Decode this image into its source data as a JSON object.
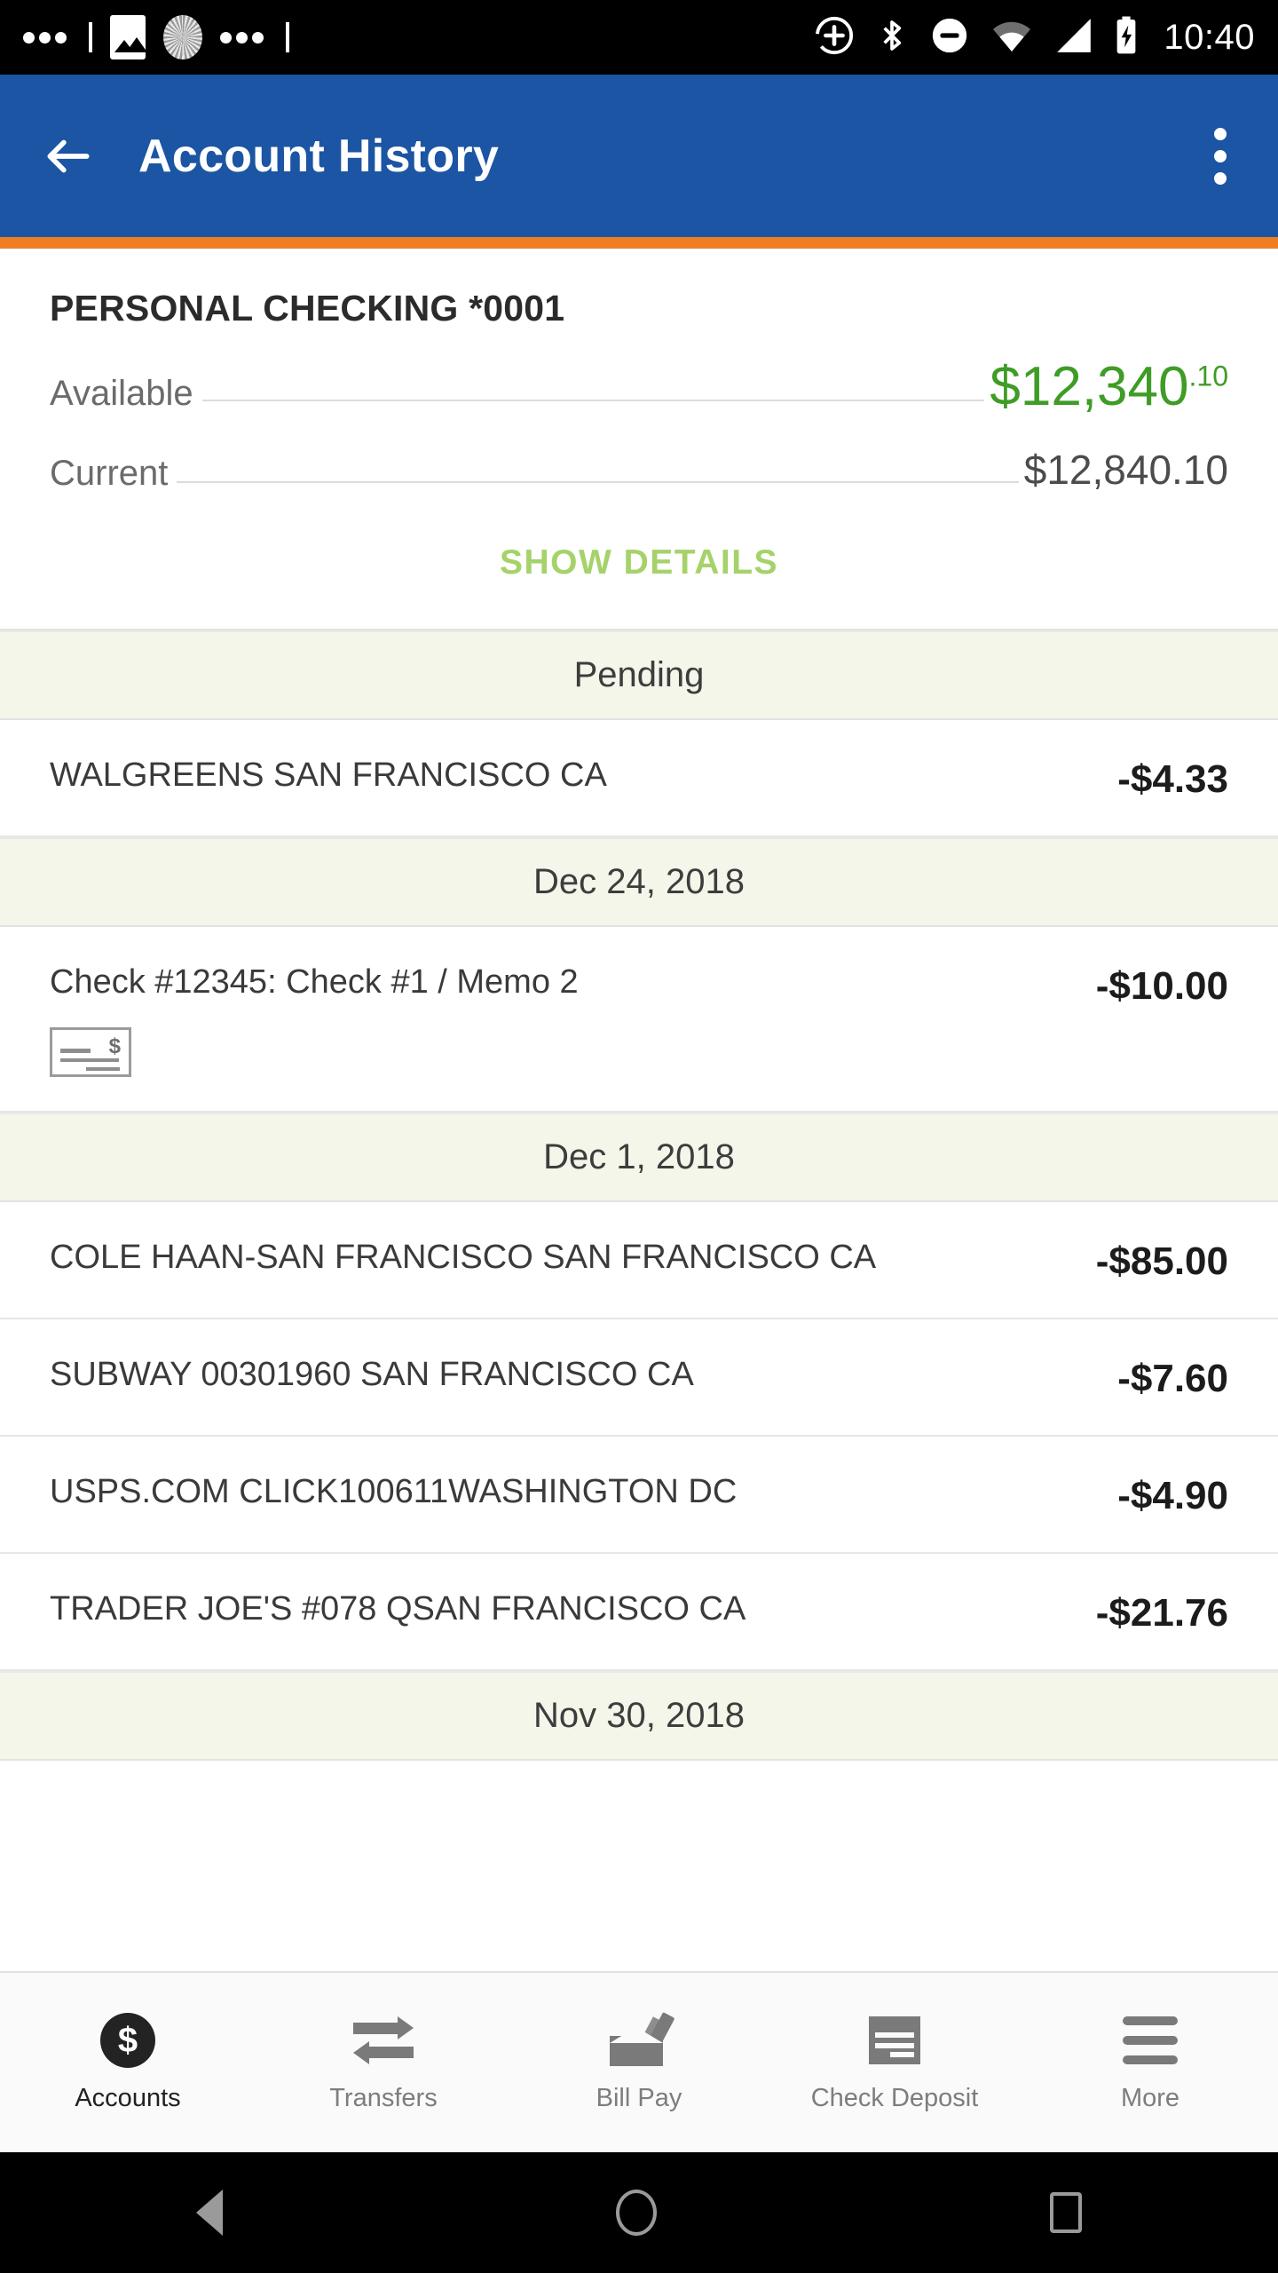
{
  "status_bar": {
    "time": "10:40",
    "left_icons": [
      "dots-icon",
      "image-icon",
      "spinner-icon",
      "dots-icon"
    ],
    "right_icons": [
      "location-add-icon",
      "bluetooth-icon",
      "do-not-disturb-icon",
      "wifi-icon",
      "signal-icon",
      "battery-charging-icon"
    ]
  },
  "app_bar": {
    "title": "Account History",
    "back_icon": "back-arrow-icon",
    "overflow_icon": "overflow-menu-icon",
    "background_color": "#1B55A3",
    "accent_color": "#F07D22"
  },
  "account": {
    "name": "PERSONAL CHECKING *0001",
    "available_label": "Available",
    "available_amount_main": "$12,340",
    "available_amount_cents": ".10",
    "available_color": "#3F9C26",
    "current_label": "Current",
    "current_amount": "$12,840.10",
    "show_details_label": "SHOW DETAILS",
    "show_details_color": "#A5D26A"
  },
  "transactions": {
    "groups": [
      {
        "header": "Pending",
        "items": [
          {
            "description": "WALGREENS SAN FRANCISCO CA",
            "amount": "-$4.33",
            "has_check_image": false
          }
        ]
      },
      {
        "header": "Dec 24, 2018",
        "items": [
          {
            "description": "Check #12345: Check #1 / Memo 2",
            "amount": "-$10.00",
            "has_check_image": true,
            "check_icon": "check-image-icon"
          }
        ]
      },
      {
        "header": "Dec 1, 2018",
        "items": [
          {
            "description": "COLE HAAN-SAN FRANCISCO SAN FRANCISCO CA",
            "amount": "-$85.00",
            "has_check_image": false
          },
          {
            "description": "SUBWAY 00301960 SAN FRANCISCO CA",
            "amount": "-$7.60",
            "has_check_image": false
          },
          {
            "description": "USPS.COM CLICK100611WASHINGTON DC",
            "amount": "-$4.90",
            "has_check_image": false
          },
          {
            "description": "TRADER JOE'S #078 QSAN FRANCISCO CA",
            "amount": "-$21.76",
            "has_check_image": false
          }
        ]
      },
      {
        "header": "Nov 30, 2018",
        "items": []
      }
    ]
  },
  "tab_bar": {
    "tabs": [
      {
        "label": "Accounts",
        "icon": "dollar-circle-icon",
        "active": true
      },
      {
        "label": "Transfers",
        "icon": "transfer-arrows-icon",
        "active": false
      },
      {
        "label": "Bill Pay",
        "icon": "envelope-pen-icon",
        "active": false
      },
      {
        "label": "Check Deposit",
        "icon": "check-document-icon",
        "active": false
      },
      {
        "label": "More",
        "icon": "hamburger-menu-icon",
        "active": false
      }
    ]
  },
  "nav_bar": {
    "back": "android-back-icon",
    "home": "android-home-icon",
    "recents": "android-recents-icon"
  }
}
